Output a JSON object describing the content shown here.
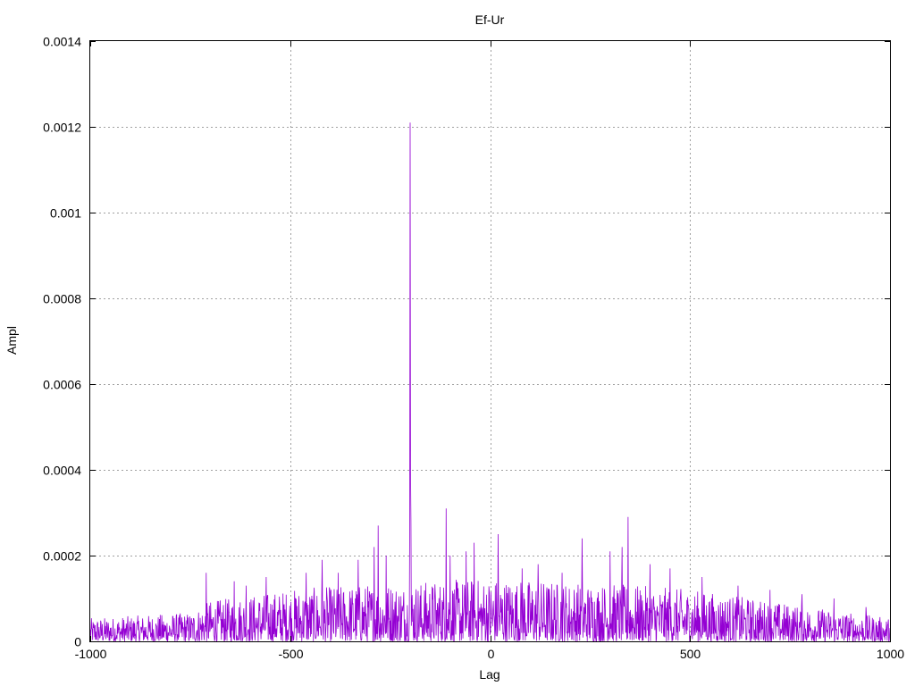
{
  "chart_data": {
    "type": "line",
    "title": "Ef-Ur",
    "xlabel": "Lag",
    "ylabel": "Ampl",
    "xlim": [
      -1000,
      1000
    ],
    "ylim": [
      0,
      0.0014
    ],
    "x_ticks": [
      -1000,
      -500,
      0,
      500,
      1000
    ],
    "x_tick_labels": [
      "-1000",
      "-500",
      "0",
      "500",
      "1000"
    ],
    "y_ticks": [
      0,
      0.0002,
      0.0004,
      0.0006,
      0.0008,
      0.001,
      0.0012,
      0.0014
    ],
    "y_tick_labels": [
      "0",
      "0.0002",
      "0.0004",
      "0.0006",
      "0.0008",
      "0.001",
      "0.0012",
      "0.0014"
    ],
    "grid": true,
    "legend": "none",
    "colors": {
      "series": "#9400d3",
      "grid": "#a0a0a0",
      "axes": "#000000"
    },
    "series": [
      {
        "x_start": -1000,
        "x_end": 1000,
        "x_step": 1,
        "noise_envelope": {
          "note": "approximate local baseline amplitude of the noisy cross-correlation trace",
          "points": [
            [
              -1000,
              4e-05
            ],
            [
              -750,
              5e-05
            ],
            [
              -700,
              7e-05
            ],
            [
              -500,
              9e-05
            ],
            [
              -300,
              0.0001
            ],
            [
              0,
              0.00011
            ],
            [
              300,
              0.0001
            ],
            [
              500,
              9e-05
            ],
            [
              700,
              7e-05
            ],
            [
              1000,
              4e-05
            ]
          ]
        },
        "peaks": [
          [
            -200,
            0.00121
          ],
          [
            -199,
            0.0004
          ],
          [
            -201,
            0.00031
          ],
          [
            -198,
            0.00028
          ],
          [
            -110,
            0.00031
          ],
          [
            -280,
            0.00027
          ],
          [
            -290,
            0.00022
          ],
          [
            -260,
            0.0002
          ],
          [
            -40,
            0.00023
          ],
          [
            -60,
            0.00021
          ],
          [
            20,
            0.00025
          ],
          [
            -100,
            0.0002
          ],
          [
            230,
            0.00024
          ],
          [
            345,
            0.00029
          ],
          [
            330,
            0.00022
          ],
          [
            300,
            0.00021
          ],
          [
            -330,
            0.00019
          ],
          [
            -420,
            0.00019
          ],
          [
            -710,
            0.00016
          ],
          [
            -640,
            0.00014
          ],
          [
            -610,
            0.00013
          ],
          [
            -560,
            0.00015
          ],
          [
            -460,
            0.00016
          ],
          [
            -380,
            0.00016
          ],
          [
            80,
            0.00017
          ],
          [
            120,
            0.00018
          ],
          [
            180,
            0.00016
          ],
          [
            400,
            0.00018
          ],
          [
            450,
            0.00017
          ],
          [
            530,
            0.00015
          ],
          [
            620,
            0.00013
          ],
          [
            700,
            0.00012
          ],
          [
            780,
            0.00011
          ],
          [
            860,
            0.0001
          ],
          [
            940,
            8e-05
          ]
        ]
      }
    ]
  }
}
